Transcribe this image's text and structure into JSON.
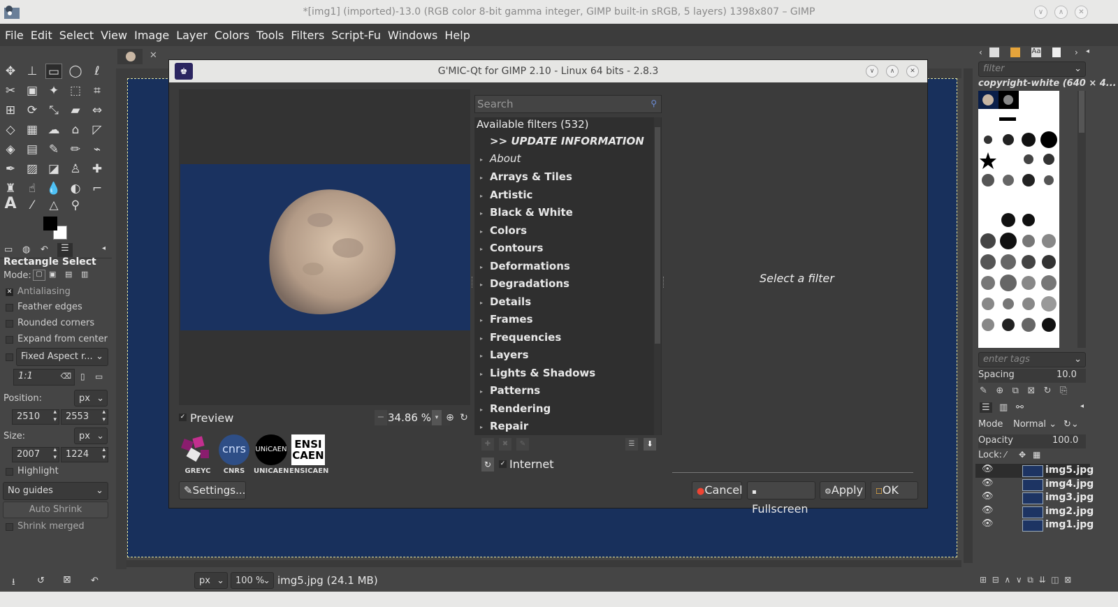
{
  "window": {
    "title": "*[img1] (imported)-13.0 (RGB color 8-bit gamma integer, GIMP built-in sRGB, 5 layers) 1398x807 – GIMP"
  },
  "menu": [
    "File",
    "Edit",
    "Select",
    "View",
    "Image",
    "Layer",
    "Colors",
    "Tools",
    "Filters",
    "Script-Fu",
    "Windows",
    "Help"
  ],
  "tool_options": {
    "title": "Rectangle Select",
    "mode_label": "Mode:",
    "antialiasing": "Antialiasing",
    "feather_edges": "Feather edges",
    "rounded_corners": "Rounded corners",
    "expand_from_center": "Expand from center",
    "fixed": "Fixed Aspect r...",
    "ratio": "1:1",
    "position_label": "Position:",
    "unit": "px",
    "pos_x": "2510",
    "pos_y": "2553",
    "size_label": "Size:",
    "size_w": "2007",
    "size_h": "1224",
    "highlight": "Highlight",
    "guides": "No guides",
    "auto_shrink": "Auto Shrink",
    "shrink_merged": "Shrink merged"
  },
  "gmic": {
    "title": "G'MIC-Qt for GIMP 2.10 - Linux 64 bits - 2.8.3",
    "search_placeholder": "Search",
    "available": "Available filters (532)",
    "update": ">> UPDATE INFORMATION",
    "about": "About",
    "categories": [
      "Arrays & Tiles",
      "Artistic",
      "Black & White",
      "Colors",
      "Contours",
      "Deformations",
      "Degradations",
      "Details",
      "Frames",
      "Frequencies",
      "Layers",
      "Lights & Shadows",
      "Patterns",
      "Rendering",
      "Repair"
    ],
    "preview_label": "Preview",
    "zoom": "34.86 %",
    "logos": [
      "GREYC",
      "CNRS",
      "UNICAEN",
      "ENSICAEN"
    ],
    "logo_texts": {
      "cnrs": "cnrs",
      "unicaen": "UNiCAEN",
      "ensicaen_top": "ENSI",
      "ensicaen_bottom": "CAEN"
    },
    "internet": "Internet",
    "select_filter": "Select a filter",
    "settings": "Settings...",
    "cancel": "Cancel",
    "fullscreen": "Fullscreen",
    "apply": "Apply",
    "ok": "OK"
  },
  "right_dock": {
    "filter_placeholder": "filter",
    "brush_name": "copyright-white (640 × 4...",
    "tags_placeholder": "enter tags",
    "spacing_label": "Spacing",
    "spacing_value": "10.0",
    "mode_label": "Mode",
    "mode_value": "Normal",
    "opacity_label": "Opacity",
    "opacity_value": "100.0",
    "lock_label": "Lock:",
    "layers": [
      "img5.jpg",
      "img4.jpg",
      "img3.jpg",
      "img2.jpg",
      "img1.jpg"
    ]
  },
  "status": {
    "unit": "px",
    "zoom": "100 %",
    "info": "img5.jpg (24.1 MB)"
  }
}
